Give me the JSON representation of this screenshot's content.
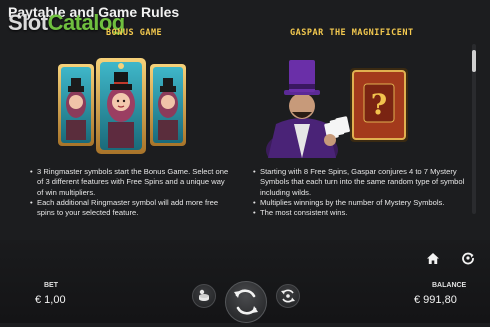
{
  "header": {
    "title": "Paytable and Game Rules"
  },
  "watermark": {
    "part1": "Slot",
    "part2": "Catalog"
  },
  "sections": {
    "left": {
      "title": "BONUS GAME",
      "bullets": [
        "3 Ringmaster symbols start the Bonus Game. Select one of 3 different features with Free Spins and a unique way of win multipliers.",
        "Each additional Ringmaster symbol will add more free spins to your selected feature."
      ]
    },
    "right": {
      "title": "GASPAR THE MAGNIFICENT",
      "bullets": [
        "Starting with 8 Free Spins, Gaspar conjures 4 to 7 Mystery Symbols that each turn into the same random type of symbol including wilds.",
        "Multiplies winnings by the number of Mystery Symbols.",
        "The most consistent wins."
      ]
    }
  },
  "footer": {
    "bet_label": "BET",
    "bet_value": "€ 1,00",
    "balance_label": "BALANCE",
    "balance_value": "€ 991,80"
  },
  "icons": {
    "home": "home-icon",
    "refresh": "refresh-icon",
    "chips": "chips-icon",
    "spin": "spin-icon",
    "autoplay": "autoplay-icon"
  },
  "colors": {
    "background": "#1c1d1f",
    "accent_gold": "#f3c94f",
    "brand_green": "#6fbf3f",
    "magician_purple": "#6a2fa8"
  }
}
